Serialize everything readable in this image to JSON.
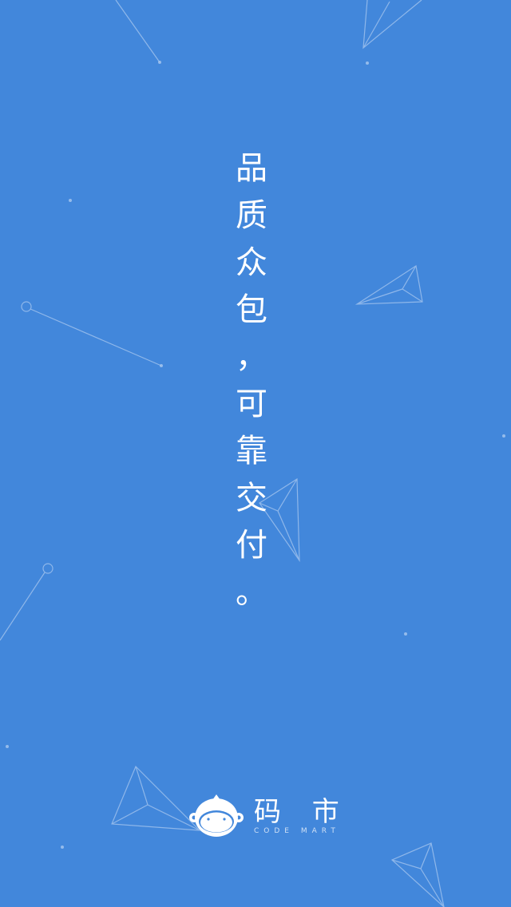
{
  "app": {
    "background_color": "#4287db",
    "decoration_color": "#a9c8ef"
  },
  "slogan": {
    "chars": [
      "品",
      "质",
      "众",
      "包",
      "，",
      "可",
      "靠",
      "交",
      "付",
      "。"
    ]
  },
  "brand": {
    "logo_icon": "monkey-logo-icon",
    "name": "码 市",
    "subtitle": "CODE MART"
  }
}
